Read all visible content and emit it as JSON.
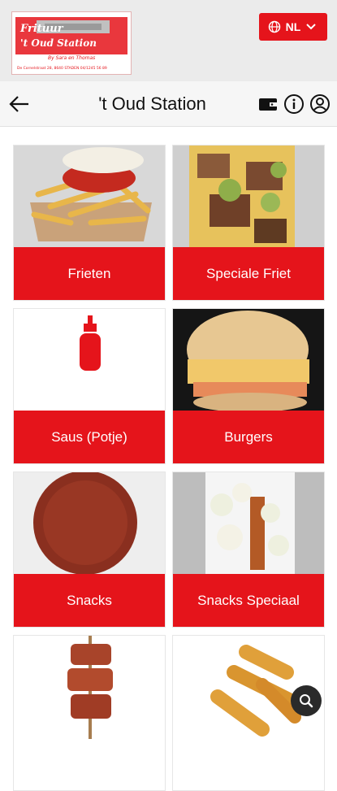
{
  "header": {
    "title": "'t Oud Station",
    "back_icon": "arrow-left-icon",
    "icons": [
      "wallet-icon",
      "info-icon",
      "account-icon"
    ]
  },
  "language": {
    "label": "NL",
    "icon": "globe-icon"
  },
  "logo": {
    "line1": "Frituur",
    "line2": "'t Oud Station",
    "tagline": "By Sara en Thomas",
    "address": "De Cornelstraat 28, 8640 STADEN 04/1245 56 89"
  },
  "categories": [
    {
      "label": "Frieten"
    },
    {
      "label": "Speciale Friet"
    },
    {
      "label": "Saus (Potje)"
    },
    {
      "label": "Burgers"
    },
    {
      "label": "Snacks"
    },
    {
      "label": "Snacks Speciaal"
    },
    {
      "label": ""
    },
    {
      "label": ""
    }
  ],
  "search_icon": "search-icon",
  "colors": {
    "accent": "#e5141b",
    "header_bg": "#ebebeb"
  }
}
